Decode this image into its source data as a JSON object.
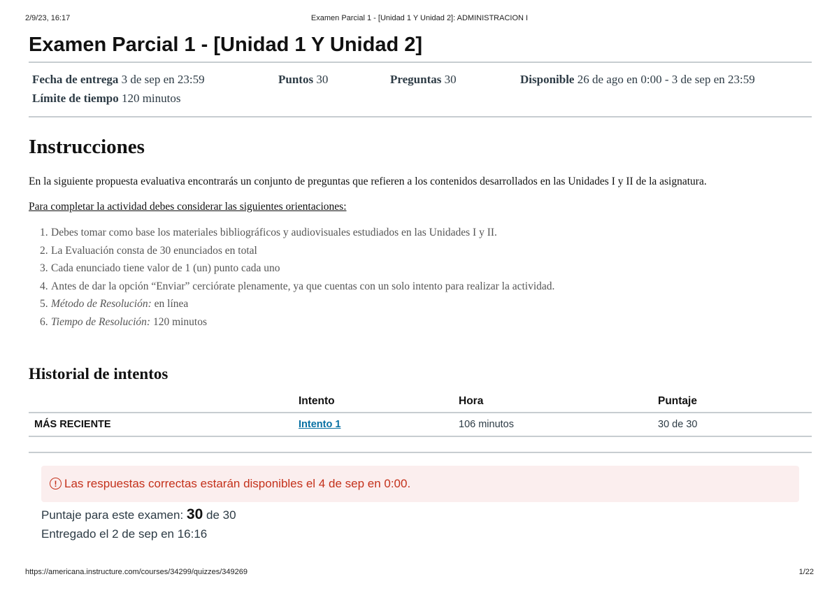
{
  "print_header": {
    "date": "2/9/23, 16:17",
    "title": "Examen Parcial 1 - [Unidad 1 Y Unidad 2]: ADMINISTRACION I"
  },
  "quiz": {
    "title": "Examen Parcial 1 - [Unidad 1 Y Unidad 2]",
    "details": {
      "due_label": "Fecha de entrega",
      "due_value": "3 de sep en 23:59",
      "points_label": "Puntos",
      "points_value": "30",
      "questions_label": "Preguntas",
      "questions_value": "30",
      "available_label": "Disponible",
      "available_value": "26 de ago en 0:00 - 3 de sep en 23:59",
      "time_limit_label": "Límite de tiempo",
      "time_limit_value": "120 minutos"
    }
  },
  "instructions": {
    "heading": "Instrucciones",
    "intro": "En la siguiente propuesta evaluativa encontrarás un conjunto de preguntas que refieren a los contenidos desarrollados en las Unidades I y II de la asignatura.",
    "orientations_title": "Para completar la actividad debes considerar las siguientes orientaciones:",
    "items": [
      {
        "num": "1.",
        "text": "Debes tomar como base los materiales bibliográficos y audiovisuales estudiados en las Unidades I y II."
      },
      {
        "num": "2.",
        "text": "La Evaluación consta de 30 enunciados en total"
      },
      {
        "num": "3.",
        "text": "Cada enunciado tiene valor de 1 (un) punto cada uno"
      },
      {
        "num": "4.",
        "text": "Antes de dar la opción “Enviar” cerciórate plenamente, ya que cuentas con un solo intento para realizar la actividad."
      },
      {
        "num": "5.",
        "em": "Método de Resolución:",
        "text": " en línea"
      },
      {
        "num": "6.",
        "em": "Tiempo de Resolución:",
        "text": " 120 minutos"
      }
    ]
  },
  "history": {
    "heading": "Historial de intentos",
    "columns": [
      "",
      "Intento",
      "Hora",
      "Puntaje"
    ],
    "rows": [
      {
        "label": "MÁS RECIENTE",
        "attempt": "Intento 1",
        "time": "106 minutos",
        "score": "30 de 30"
      }
    ]
  },
  "alert": {
    "icon": "!",
    "text": "Las respuestas correctas estarán disponibles el 4 de sep en 0:00."
  },
  "score": {
    "label": "Puntaje para este examen:",
    "value": "30",
    "suffix": "de 30"
  },
  "submitted": "Entregado el 2 de sep en 16:16",
  "print_footer": {
    "url": "https://americana.instructure.com/courses/34299/quizzes/349269",
    "page": "1/22"
  },
  "colors": {
    "alert_bg": "#fbeeee",
    "alert_text": "#c4311b",
    "link": "#0770a3",
    "divider": "#c7cdd1"
  }
}
